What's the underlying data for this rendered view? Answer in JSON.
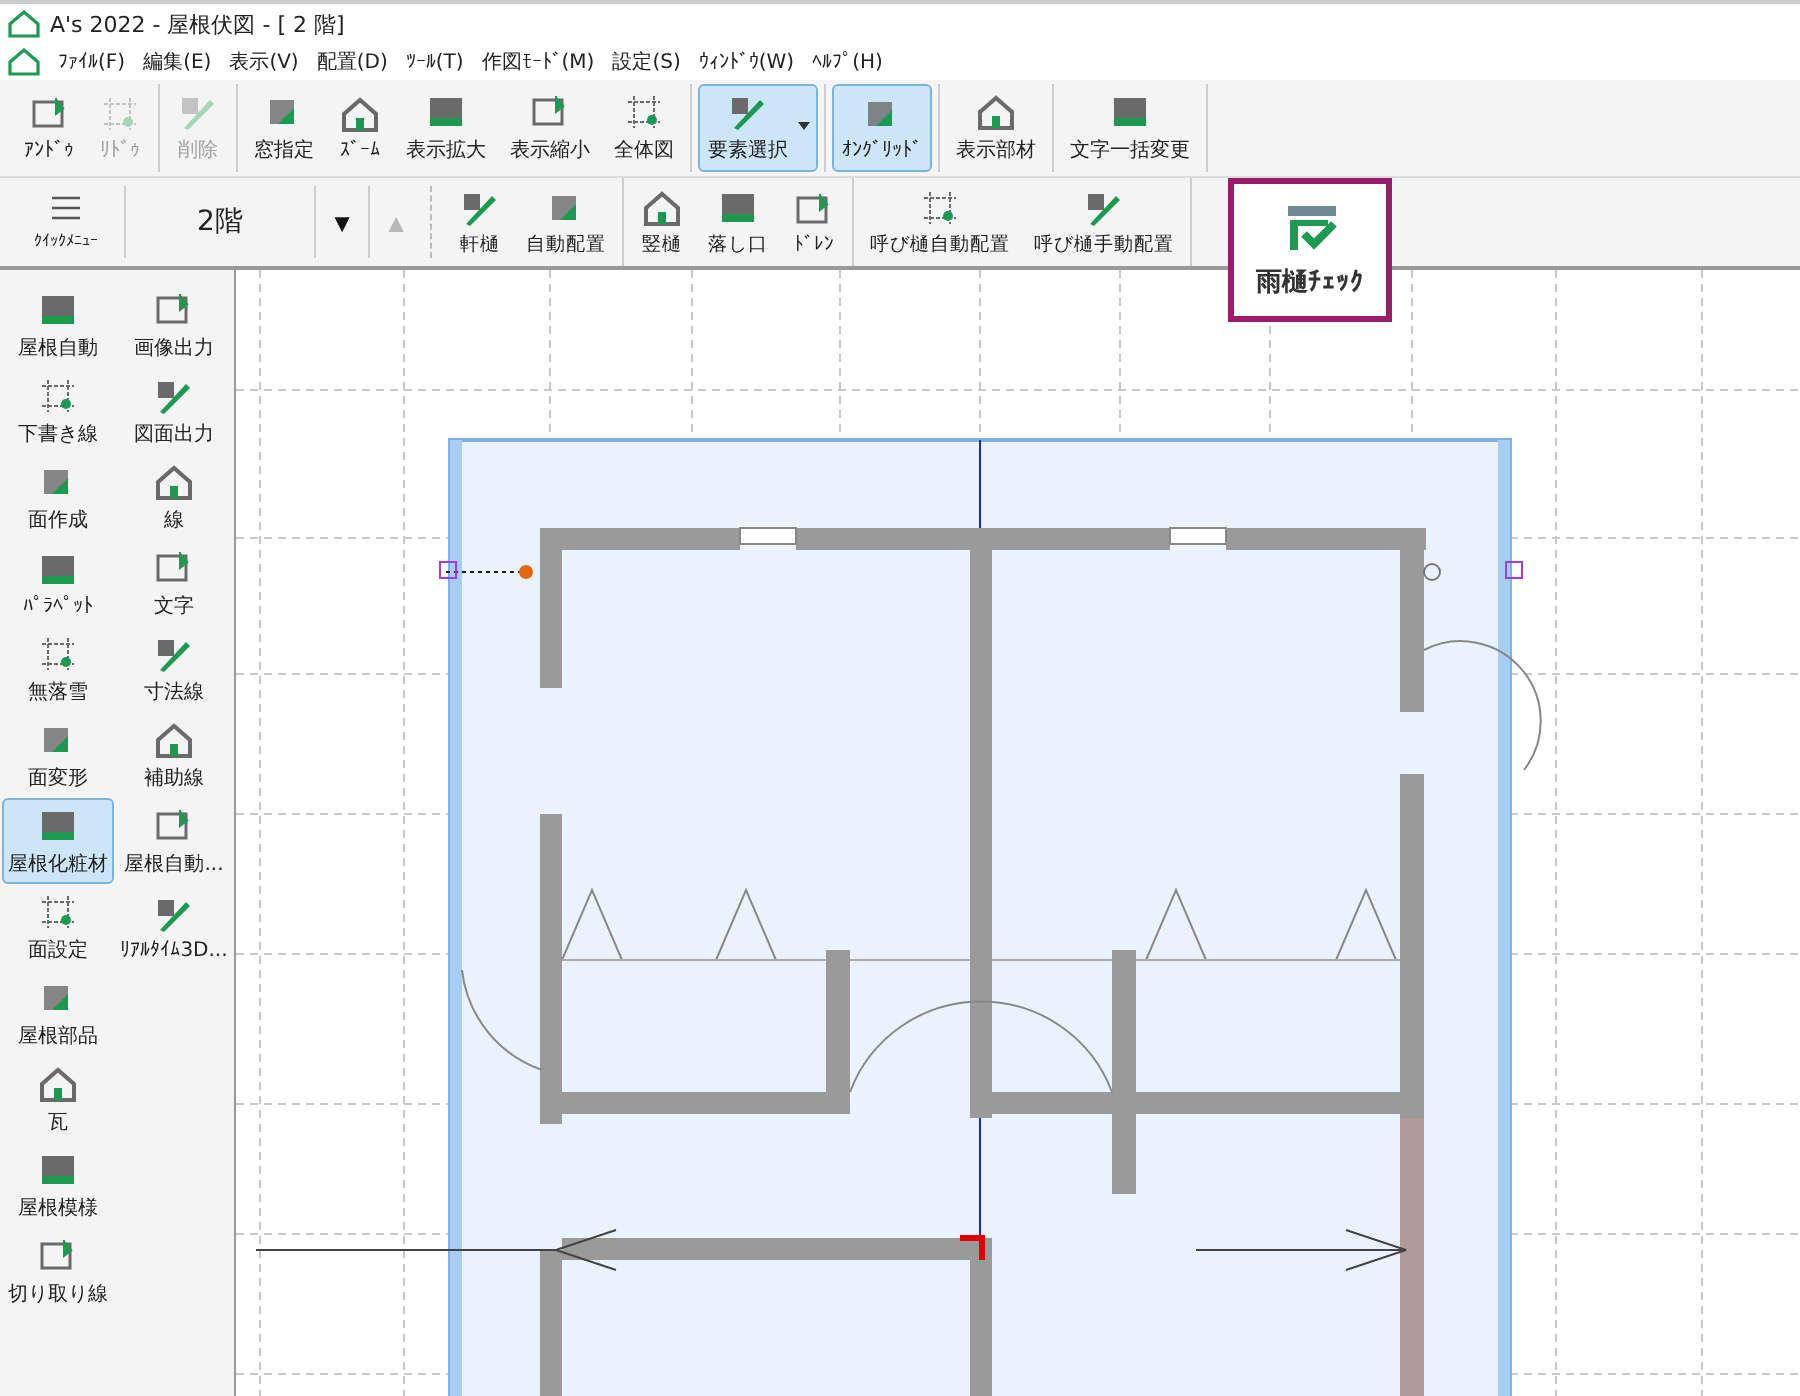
{
  "window": {
    "title": "A's 2022 - 屋根伏図 - [ 2 階]"
  },
  "menu": [
    "ﾌｧｲﾙ(F)",
    "編集(E)",
    "表示(V)",
    "配置(D)",
    "ﾂｰﾙ(T)",
    "作図ﾓｰﾄﾞ(M)",
    "設定(S)",
    "ｳｨﾝﾄﾞｳ(W)",
    "ﾍﾙﾌﾟ(H)"
  ],
  "toolbar": {
    "groups": [
      [
        {
          "label": "ｱﾝﾄﾞｩ",
          "kind": "button",
          "selected": false,
          "disabled": false
        },
        {
          "label": "ﾘﾄﾞｩ",
          "kind": "button",
          "selected": false,
          "disabled": true
        }
      ],
      [
        {
          "label": "削除",
          "kind": "button",
          "selected": false,
          "disabled": true
        }
      ],
      [
        {
          "label": "窓指定",
          "kind": "button",
          "selected": false,
          "disabled": false
        },
        {
          "label": "ｽﾞｰﾑ",
          "kind": "button",
          "selected": false,
          "disabled": false
        },
        {
          "label": "表示拡大",
          "kind": "button",
          "selected": false,
          "disabled": false
        },
        {
          "label": "表示縮小",
          "kind": "button",
          "selected": false,
          "disabled": false
        },
        {
          "label": "全体図",
          "kind": "button",
          "selected": false,
          "disabled": false
        }
      ],
      [
        {
          "label": "要素選択",
          "kind": "split",
          "selected": true,
          "disabled": false
        }
      ],
      [
        {
          "label": "ｵﾝｸﾞﾘｯﾄﾞ",
          "kind": "button",
          "selected": true,
          "disabled": false
        }
      ],
      [
        {
          "label": "表示部材",
          "kind": "button",
          "selected": false,
          "disabled": false
        }
      ],
      [
        {
          "label": "文字一括変更",
          "kind": "button",
          "selected": false,
          "disabled": false
        }
      ]
    ]
  },
  "gutter_bar": {
    "quick_menu": "ｸｲｯｸﾒﾆｭｰ",
    "floor": "2階",
    "floor_down": {
      "label": "▼",
      "disabled": false
    },
    "floor_up": {
      "label": "▲",
      "disabled": true
    },
    "groups": [
      [
        {
          "label": "軒樋"
        },
        {
          "label": "自動配置"
        }
      ],
      [
        {
          "label": "竪樋"
        },
        {
          "label": "落し口"
        },
        {
          "label": "ﾄﾞﾚﾝ"
        }
      ],
      [
        {
          "label": "呼び樋自動配置"
        },
        {
          "label": "呼び樋手動配置"
        }
      ]
    ],
    "check_button": {
      "label": "雨樋ﾁｪｯｸ",
      "highlighted": true
    }
  },
  "sidebar": {
    "items": [
      {
        "label": "屋根自動",
        "selected": false
      },
      {
        "label": "画像出力",
        "selected": false
      },
      {
        "label": "下書き線",
        "selected": false
      },
      {
        "label": "図面出力",
        "selected": false
      },
      {
        "label": "面作成",
        "selected": false
      },
      {
        "label": "線",
        "selected": false
      },
      {
        "label": "ﾊﾟﾗﾍﾟｯﾄ",
        "selected": false
      },
      {
        "label": "文字",
        "selected": false
      },
      {
        "label": "無落雪",
        "selected": false
      },
      {
        "label": "寸法線",
        "selected": false
      },
      {
        "label": "面変形",
        "selected": false
      },
      {
        "label": "補助線",
        "selected": false
      },
      {
        "label": "屋根化粧材",
        "selected": true
      },
      {
        "label": "屋根自動...",
        "selected": false
      },
      {
        "label": "面設定",
        "selected": false
      },
      {
        "label": "ﾘｱﾙﾀｲﾑ3D...",
        "selected": false
      },
      {
        "label": "屋根部品",
        "selected": false
      },
      {
        "label": "瓦",
        "selected": false
      },
      {
        "label": "屋根模様",
        "selected": false
      },
      {
        "label": "切り取り線",
        "selected": false
      }
    ]
  }
}
